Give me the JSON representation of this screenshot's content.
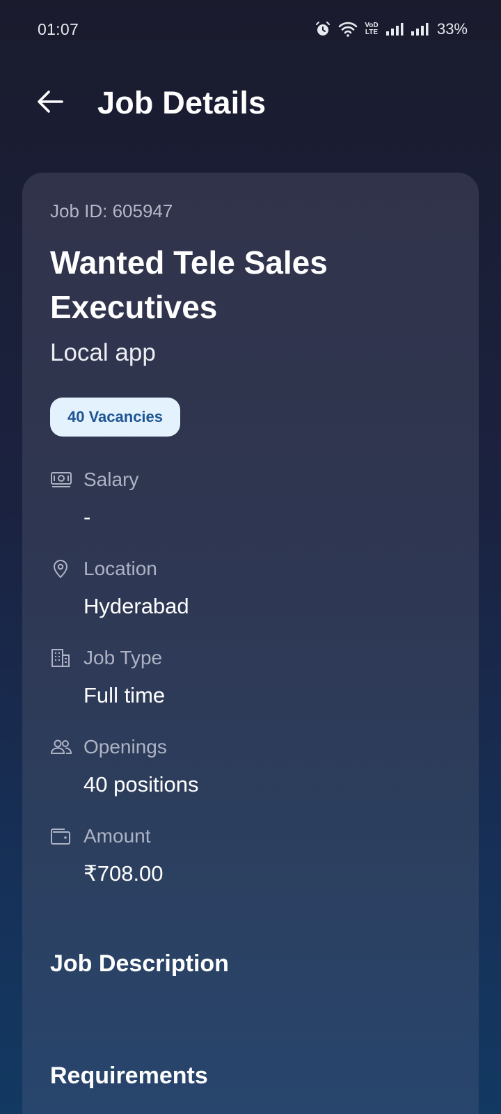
{
  "status_bar": {
    "time": "01:07",
    "network_label": "VoD LTE",
    "battery": "33%",
    "icons": [
      "alarm-icon",
      "wifi-icon",
      "signal-icon",
      "signal-icon",
      "battery"
    ]
  },
  "header": {
    "title": "Job Details",
    "back_icon": "arrow-left-icon"
  },
  "job": {
    "id_label": "Job ID: 605947",
    "title": "Wanted Tele Sales Executives",
    "company": "Local app",
    "vacancies_badge": "40 Vacancies",
    "details": {
      "salary": {
        "label": "Salary",
        "value": "-",
        "icon": "money-icon"
      },
      "location": {
        "label": "Location",
        "value": "Hyderabad",
        "icon": "location-pin-icon"
      },
      "job_type": {
        "label": "Job Type",
        "value": "Full time",
        "icon": "building-icon"
      },
      "openings": {
        "label": "Openings",
        "value": "40 positions",
        "icon": "people-icon"
      },
      "amount": {
        "label": "Amount",
        "value": "₹708.00",
        "icon": "wallet-icon"
      }
    },
    "sections": {
      "description_title": "Job Description",
      "requirements_title": "Requirements"
    }
  },
  "colors": {
    "badge_bg": "#e4f2fd",
    "badge_text": "#1d5493",
    "label_text": "#aeb3c4"
  }
}
